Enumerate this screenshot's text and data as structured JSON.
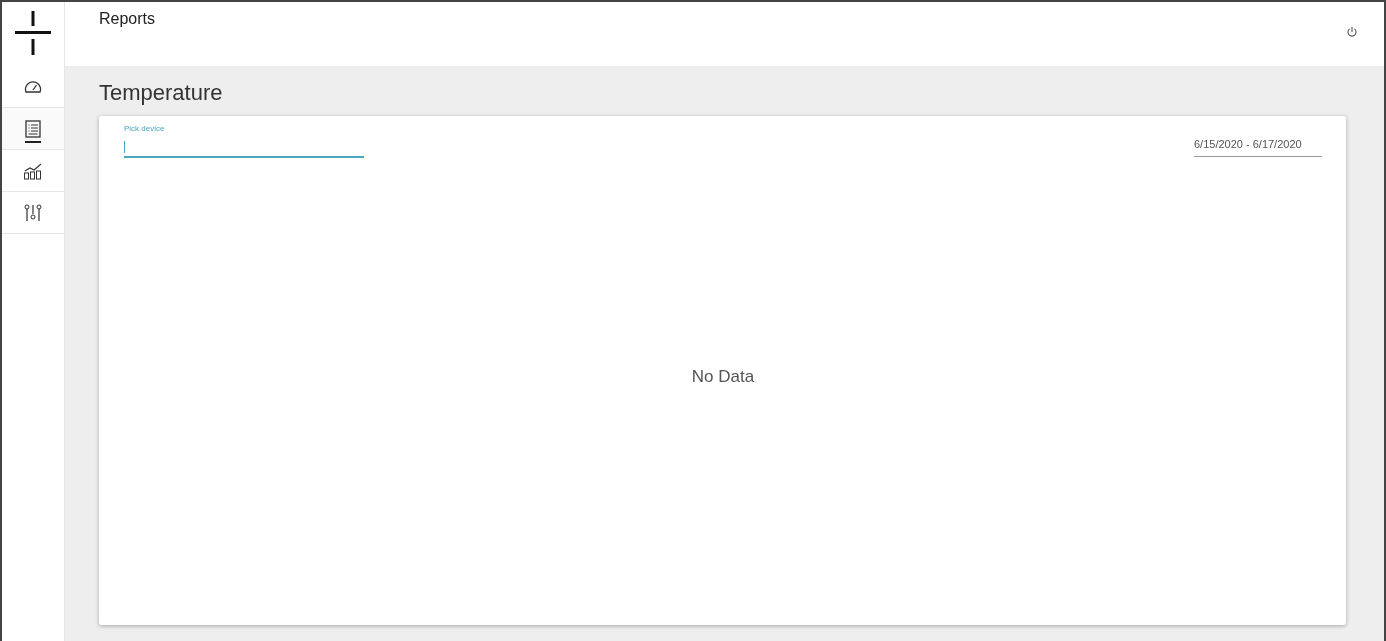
{
  "nav": [
    {
      "kind": "dashboard",
      "selected": false
    },
    {
      "kind": "reports",
      "selected": true
    },
    {
      "kind": "analytics",
      "selected": false
    },
    {
      "kind": "settings",
      "selected": false
    }
  ],
  "header": {
    "title": "Reports"
  },
  "page": {
    "title": "Temperature"
  },
  "device_field": {
    "label": "Pick device"
  },
  "date_range": {
    "value": "6/15/2020 - 6/17/2020"
  },
  "empty_message": "No Data"
}
